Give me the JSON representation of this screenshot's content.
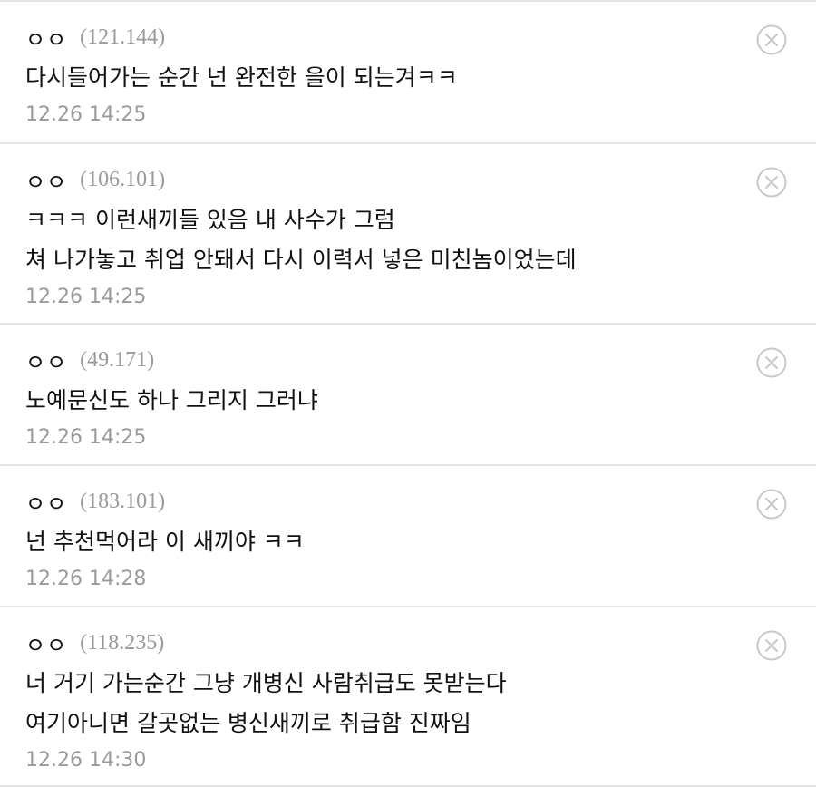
{
  "comments": [
    {
      "author": "ㅇㅇ",
      "ip": "(121.144)",
      "lines": [
        "다시들어가는 순간 넌 완전한 을이 되는겨ㅋㅋ"
      ],
      "time": "12.26 14:25"
    },
    {
      "author": "ㅇㅇ",
      "ip": "(106.101)",
      "lines": [
        "ㅋㅋㅋ 이런새끼들 있음 내 사수가 그럼",
        "쳐 나가놓고 취업 안돼서 다시 이력서 넣은 미친놈이었는데"
      ],
      "time": "12.26 14:25"
    },
    {
      "author": "ㅇㅇ",
      "ip": "(49.171)",
      "lines": [
        "노예문신도 하나 그리지 그러냐"
      ],
      "time": "12.26 14:25"
    },
    {
      "author": "ㅇㅇ",
      "ip": "(183.101)",
      "lines": [
        "넌 추천먹어라 이 새끼야 ㅋㅋ"
      ],
      "time": "12.26 14:28"
    },
    {
      "author": "ㅇㅇ",
      "ip": "(118.235)",
      "lines": [
        "너 거기 가는순간 그냥 개병신 사람취급도 못받는다",
        "여기아니면 갈곳없는 병신새끼로 취급함 진짜임"
      ],
      "time": "12.26 14:30"
    }
  ],
  "delete_icon": "close-circle-icon",
  "colors": {
    "text": "#111111",
    "muted": "#9a9a9a",
    "divider": "#e3e3e3",
    "icon": "#c8c8c8"
  }
}
